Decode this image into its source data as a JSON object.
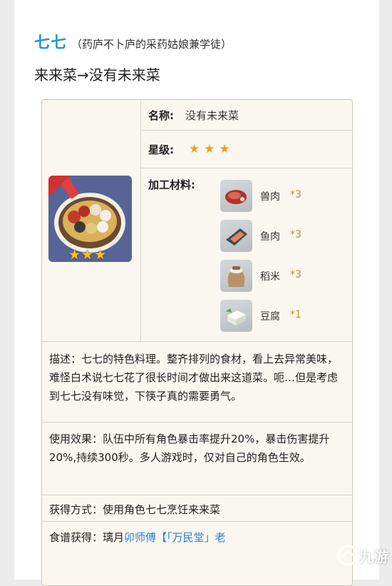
{
  "header": {
    "character_name": "七七",
    "character_desc": "（药庐不卜庐的采药姑娘兼学徒）",
    "dish_line": "来来菜→没有未来菜"
  },
  "card": {
    "name_label": "名称:",
    "name_value": "没有未来菜",
    "rarity_label": "星级:",
    "rarity_stars": 3,
    "rarity_stars_text": "★★★",
    "dish_image_stars_text": "★★★",
    "materials_label": "加工材料:",
    "materials": [
      {
        "name": "兽肉",
        "qty": "*3",
        "icon": "raw-meat-icon"
      },
      {
        "name": "鱼肉",
        "qty": "*3",
        "icon": "fish-icon"
      },
      {
        "name": "稻米",
        "qty": "*3",
        "icon": "rice-sack-icon"
      },
      {
        "name": "豆腐",
        "qty": "*1",
        "icon": "tofu-icon"
      }
    ],
    "description": "描述：七七的特色料理。整齐排列的食材，看上去异常美味，难怪白术说七七花了很长时间才做出来这道菜。呃…但是考虑到七七没有味觉，下筷子真的需要勇气。",
    "effect": "使用效果：队伍中所有角色暴击率提升20%，暴击伤害提升20%,持续300秒。多人游戏时，仅对自己的角色生效。",
    "obtain": "获得方式：使用角色七七烹饪来来菜",
    "recipe_label": "食谱获得：璃月",
    "recipe_link": "卯师傅【「万民堂」老"
  },
  "watermark": {
    "text": "九游"
  },
  "colors": {
    "accent_blue": "#1e9ad6",
    "star_gold": "#e8a317",
    "qty_gold": "#c78a2c",
    "card_bg": "#faf7f1",
    "link_blue": "#2a7fd0"
  }
}
